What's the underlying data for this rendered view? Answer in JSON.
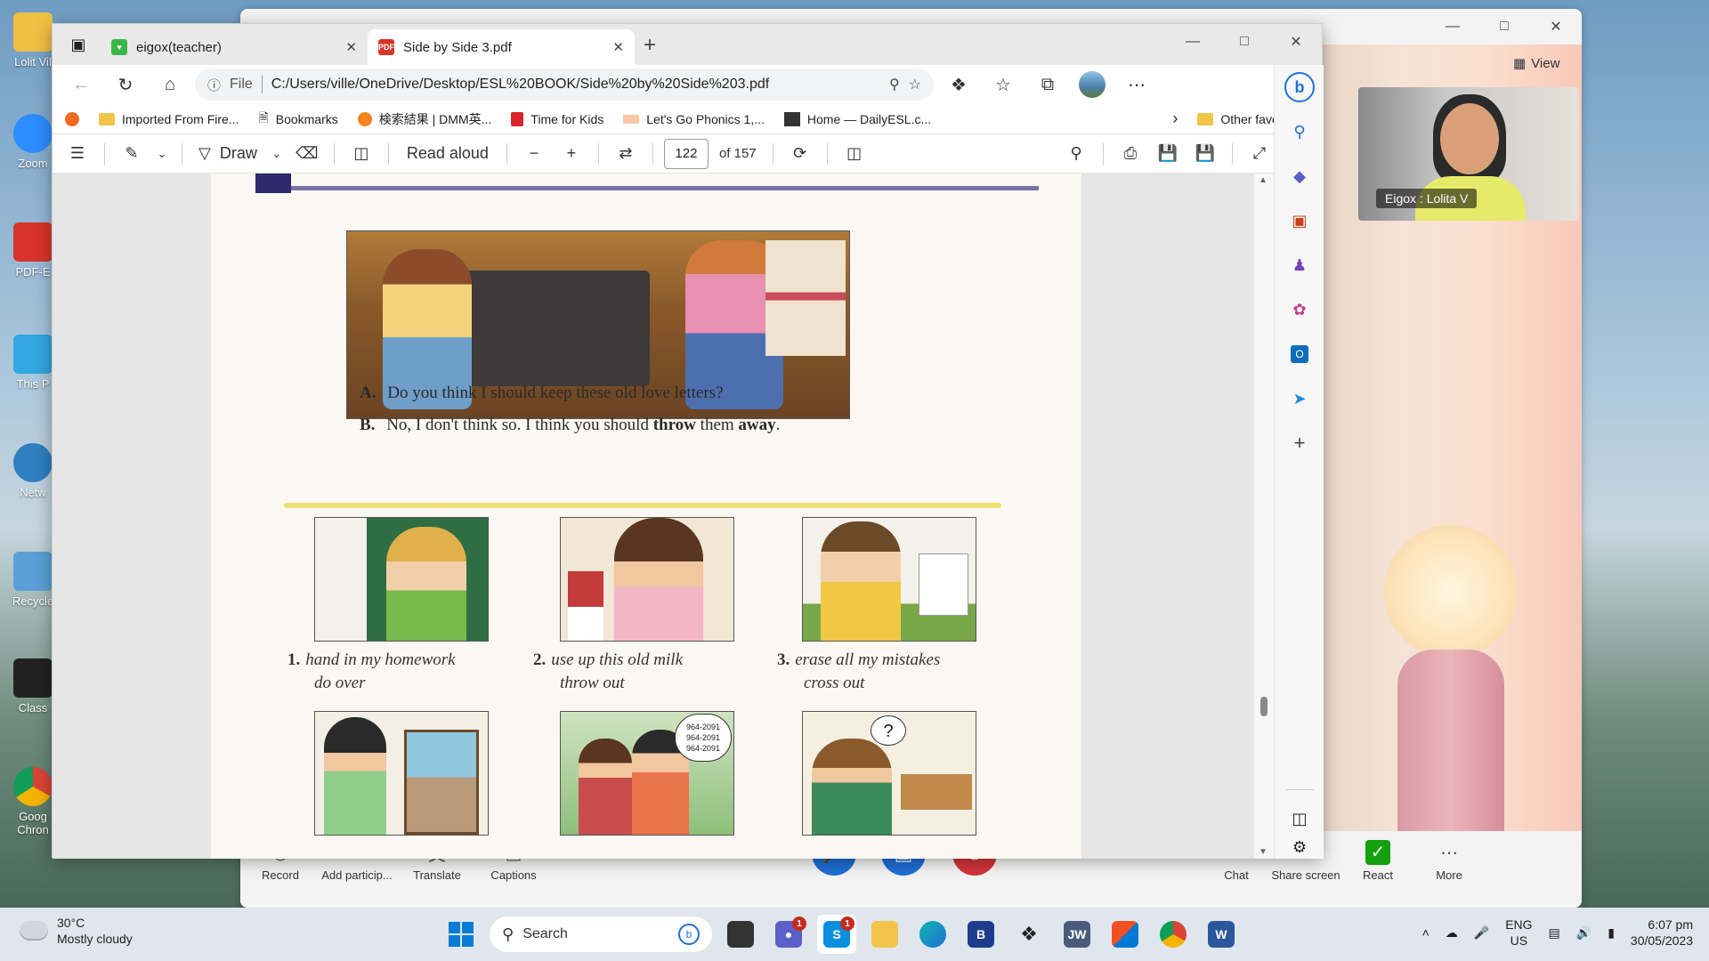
{
  "desktop": {
    "icons": [
      {
        "label": "Lolit Vil",
        "color": "#f0c043"
      },
      {
        "label": "Zoom",
        "color": "#2d8cff"
      },
      {
        "label": "PDF-E",
        "color": "#d9342b"
      },
      {
        "label": "This P",
        "color": "#34a6e0"
      },
      {
        "label": "Netw",
        "color": "#2f7fc1"
      },
      {
        "label": "Recycle",
        "color": "#5aa0d6"
      },
      {
        "label": "Class",
        "color": "#222222"
      },
      {
        "label": "Goog Chron",
        "color": "#4285f4"
      }
    ]
  },
  "call": {
    "view_label": "View",
    "participant_name": "Eigox : Lolita V",
    "controls": {
      "record": "Record",
      "add_participants": "Add particip...",
      "translate": "Translate",
      "captions": "Captions",
      "chat": "Chat",
      "share_screen": "Share screen",
      "react": "React",
      "more": "More"
    }
  },
  "browser": {
    "tabs": [
      {
        "title": "eigox(teacher)",
        "active": false
      },
      {
        "title": "Side by Side 3.pdf",
        "active": true
      }
    ],
    "address": {
      "scheme_label": "File",
      "url": "C:/Users/ville/OneDrive/Desktop/ESL%20BOOK/Side%20by%20Side%203.pdf"
    },
    "favourites": [
      {
        "label": "Imported From Fire...",
        "icon": "folder-icon"
      },
      {
        "label": "Bookmarks",
        "icon": "page-icon"
      },
      {
        "label": "検索結果 | DMM英...",
        "icon": "dmm-icon"
      },
      {
        "label": "Time for Kids",
        "icon": "tfk-icon"
      },
      {
        "label": "Let's Go Phonics 1,...",
        "icon": "phonics-icon"
      },
      {
        "label": "Home — DailyESL.c...",
        "icon": "dailyesl-icon"
      }
    ],
    "other_favourites": "Other favourites",
    "pdf_toolbar": {
      "draw": "Draw",
      "read_aloud": "Read aloud",
      "page_current": "122",
      "page_total": "of 157"
    }
  },
  "pdf": {
    "dialog_a_label": "A.",
    "dialog_a": "Do you think I should keep these old love letters?",
    "dialog_b_label": "B.",
    "dialog_b_start": "No, I don't think so.  I think you should ",
    "dialog_b_bold1": "throw",
    "dialog_b_mid": " them ",
    "dialog_b_bold2": "away",
    "dialog_b_end": ".",
    "exercises": [
      {
        "num": "1.",
        "line1": "hand in my homework",
        "line2": "do over"
      },
      {
        "num": "2.",
        "line1": "use up this old milk",
        "line2": "throw out"
      },
      {
        "num": "3.",
        "line1": "erase all my mistakes",
        "line2": "cross out"
      }
    ],
    "phone_bubble": [
      "964-2091",
      "964-2091",
      "964-2091"
    ]
  },
  "taskbar": {
    "temperature": "30°C",
    "weather": "Mostly cloudy",
    "search": "Search",
    "teams_badge": "1",
    "skype_badge": "1",
    "lang_1": "ENG",
    "lang_2": "US",
    "time": "6:07 pm",
    "date": "30/05/2023"
  }
}
